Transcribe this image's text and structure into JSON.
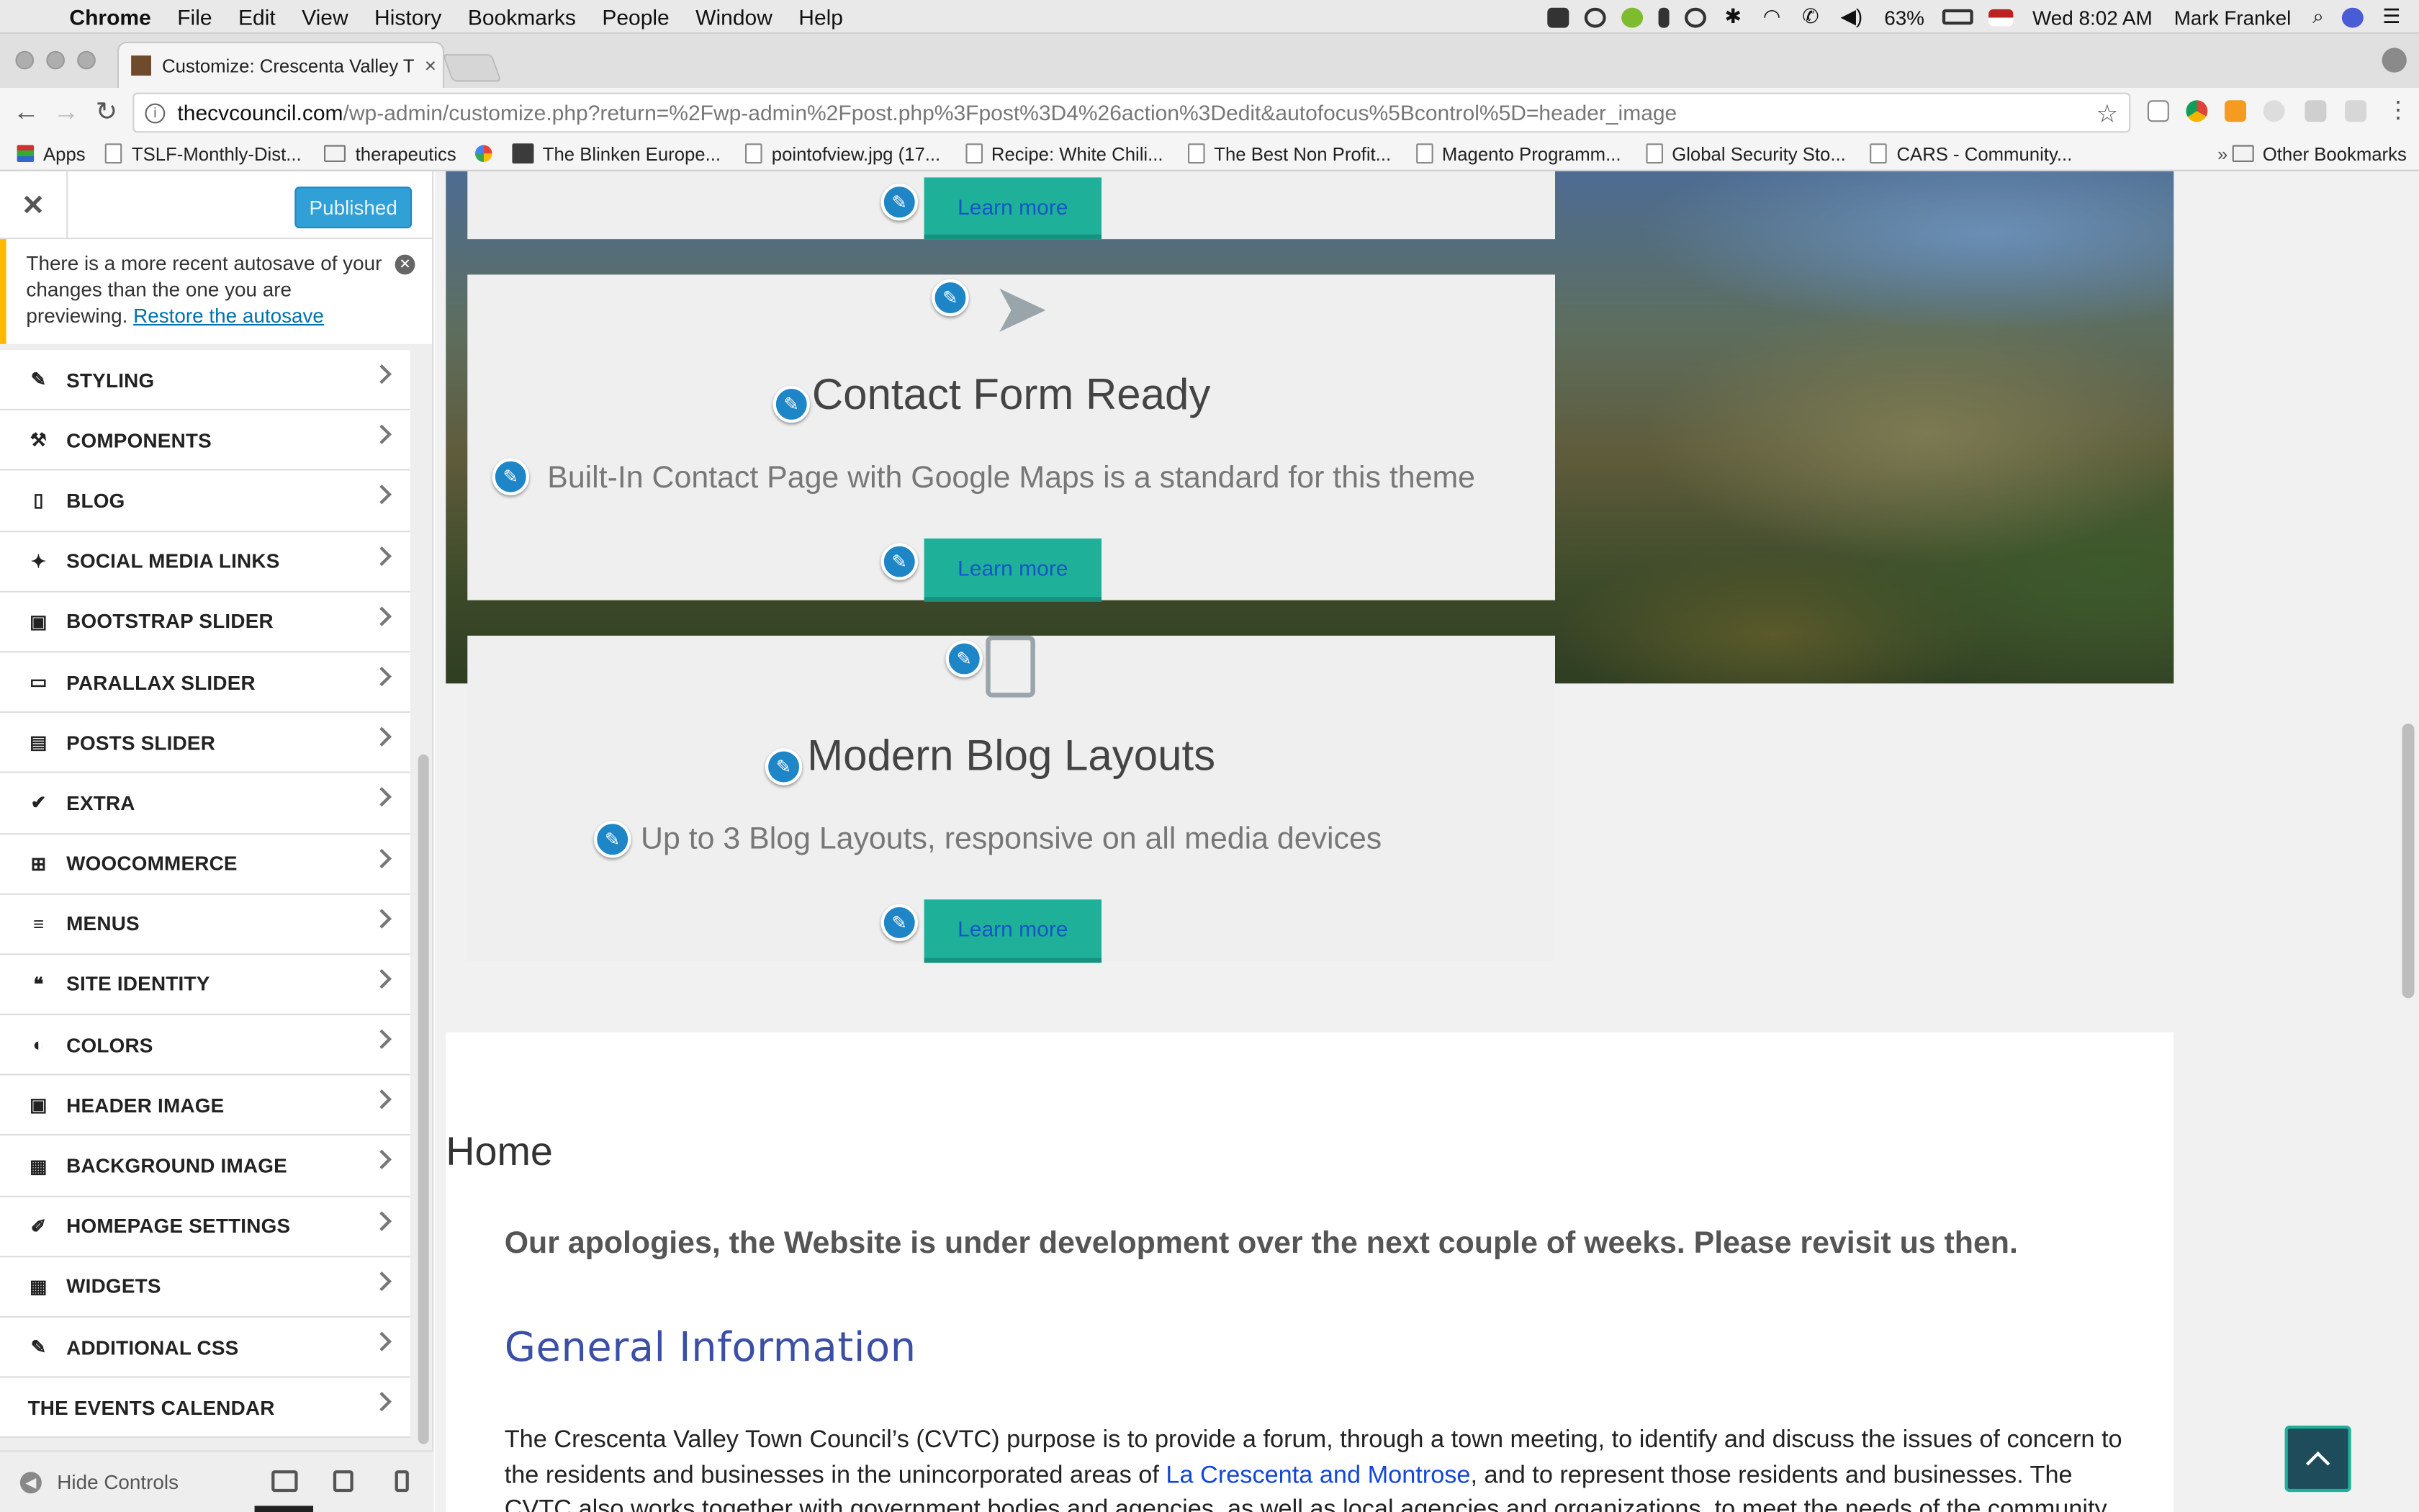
{
  "menubar": {
    "app": "Chrome",
    "menus": [
      "File",
      "Edit",
      "View",
      "History",
      "Bookmarks",
      "People",
      "Window",
      "Help"
    ],
    "battery": "63%",
    "datetime": "Wed 8:02 AM",
    "user": "Mark Frankel"
  },
  "tab": {
    "title": "Customize: Crescenta Valley T"
  },
  "address": {
    "domain": "thecvcouncil.com",
    "path": "/wp-admin/customize.php?return=%2Fwp-admin%2Fpost.php%3Fpost%3D4%26action%3Dedit&autofocus%5Bcontrol%5D=header_image"
  },
  "bookmarks": {
    "items": [
      "Apps",
      "TSLF-Monthly-Dist...",
      "therapeutics",
      "",
      "The Blinken Europe...",
      "pointofview.jpg (17...",
      "Recipe: White Chili...",
      "The Best Non Profit...",
      "Magento Programm...",
      "Global Security Sto...",
      "CARS - Community..."
    ],
    "more": "»",
    "other": "Other Bookmarks"
  },
  "customizer": {
    "publish_label": "Published",
    "autosave_text": "There is a more recent autosave of your changes than the one you are previewing.",
    "autosave_link": "Restore the autosave",
    "sections": [
      {
        "label": "STYLING",
        "icon": "brush-icon"
      },
      {
        "label": "COMPONENTS",
        "icon": "hammer-icon"
      },
      {
        "label": "BLOG",
        "icon": "page-icon"
      },
      {
        "label": "SOCIAL MEDIA LINKS",
        "icon": "twitter-icon"
      },
      {
        "label": "BOOTSTRAP SLIDER",
        "icon": "image-icon"
      },
      {
        "label": "PARALLAX SLIDER",
        "icon": "desktop-icon"
      },
      {
        "label": "POSTS SLIDER",
        "icon": "slides-icon"
      },
      {
        "label": "EXTRA",
        "icon": "check-icon"
      },
      {
        "label": "WOOCOMMERCE",
        "icon": "cart-icon"
      },
      {
        "label": "MENUS",
        "icon": "menu-icon"
      },
      {
        "label": "SITE IDENTITY",
        "icon": "quote-icon"
      },
      {
        "label": "COLORS",
        "icon": "palette-icon"
      },
      {
        "label": "HEADER IMAGE",
        "icon": "header-image-icon"
      },
      {
        "label": "BACKGROUND IMAGE",
        "icon": "background-image-icon"
      },
      {
        "label": "HOMEPAGE SETTINGS",
        "icon": "edit-page-icon"
      },
      {
        "label": "WIDGETS",
        "icon": "widgets-icon"
      },
      {
        "label": "ADDITIONAL CSS",
        "icon": "pencil-icon"
      },
      {
        "label": "THE EVENTS CALENDAR",
        "icon": ""
      }
    ],
    "hide_controls": "Hide Controls"
  },
  "preview": {
    "learn_more": "Learn more",
    "features": [
      {
        "title": "Contact Form Ready",
        "text": "Built-In Contact Page with Google Maps is a standard for this theme"
      },
      {
        "title": "Modern Blog Layouts",
        "text": "Up to 3 Blog Layouts, responsive on all media devices"
      }
    ],
    "page_title": "Home",
    "apology": "Our apologies, the Website is under development over the next couple of weeks. Please revisit us then.",
    "section_heading": "General Information",
    "para_start": "The Crescenta Valley Town Council’s (CVTC) purpose is to provide a forum, through a town meeting, to identify and discuss the issues of concern to the residents and businesses in the unincorporated areas of ",
    "para_link": "La Crescenta and Montrose",
    "para_end": ", and to represent those residents and businesses. The CVTC also works together with government bodies and agencies, as well as local agencies and organizations, to meet the needs of the community. The Council is composed of"
  }
}
